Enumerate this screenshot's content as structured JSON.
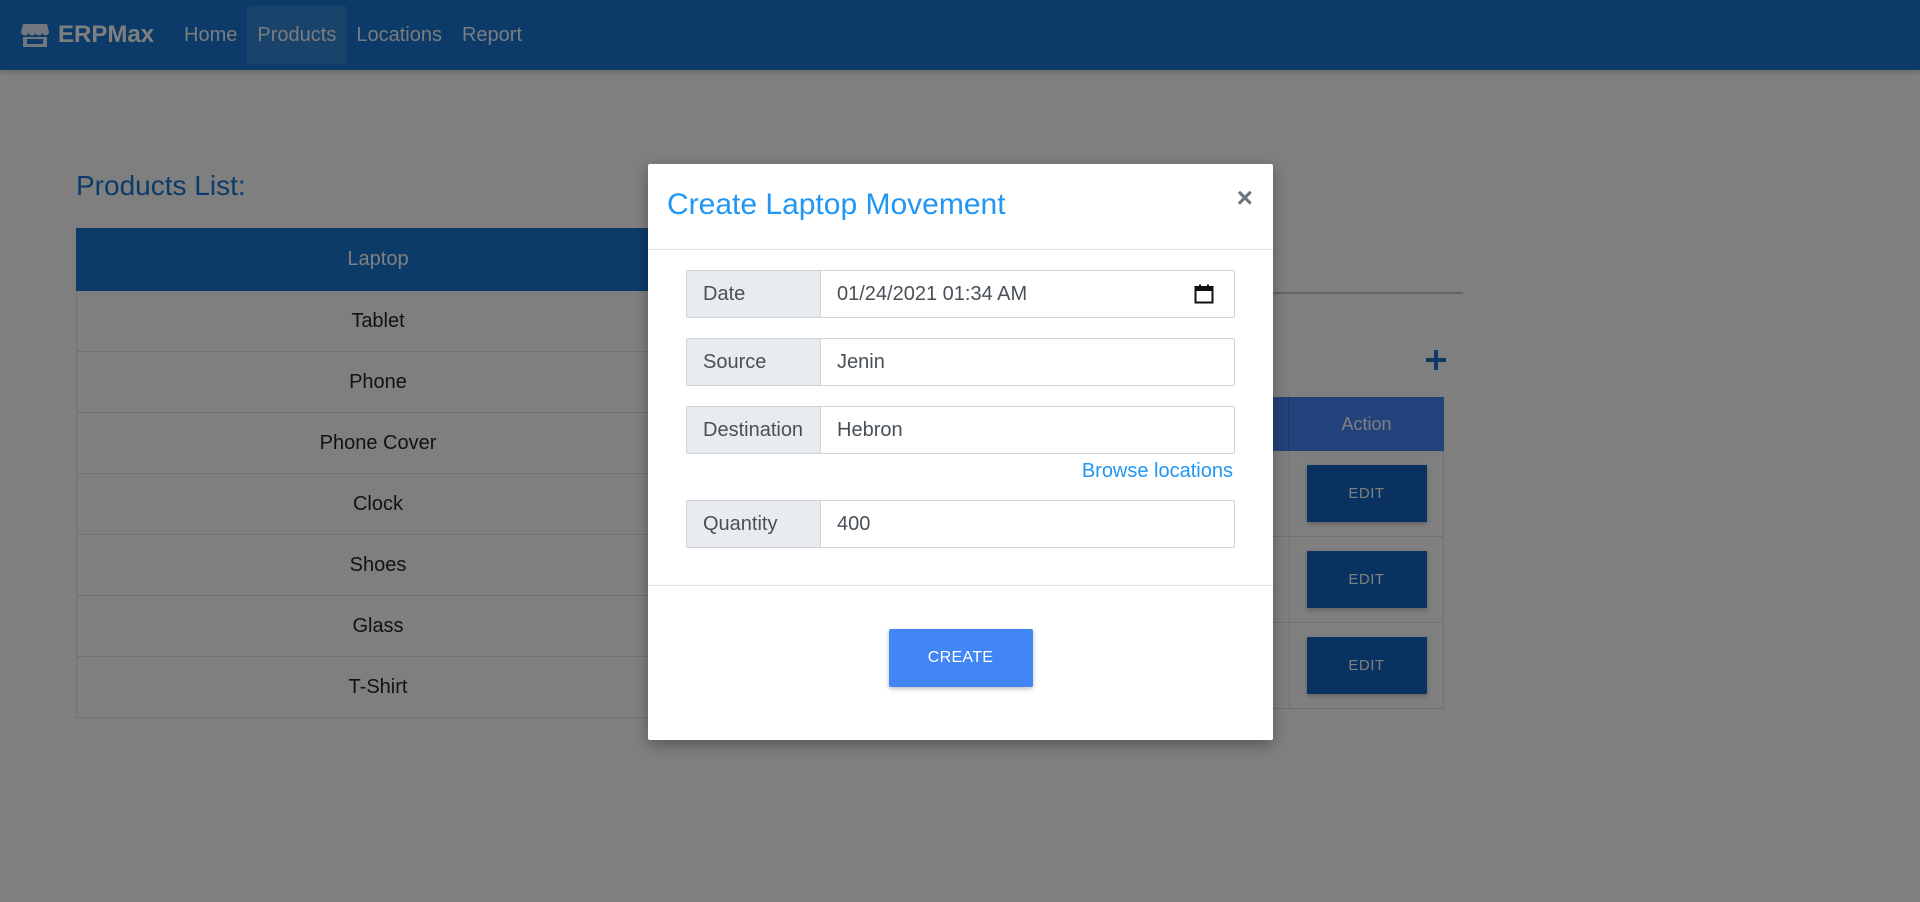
{
  "navbar": {
    "brand": "ERPMax",
    "brand_icon": "store-icon",
    "links": [
      "Home",
      "Products",
      "Locations",
      "Report"
    ],
    "active_link": "Products",
    "color": "#1976d2"
  },
  "products": {
    "title": "Products List:",
    "items": [
      "Laptop",
      "Tablet",
      "Phone",
      "Phone Cover",
      "Clock",
      "Shoes",
      "Glass",
      "T-Shirt"
    ],
    "selected": "Laptop"
  },
  "movements_table": {
    "action_header": "Action",
    "edit_label": "EDIT",
    "rows": 3
  },
  "modal": {
    "title": "Create Laptop Movement",
    "close_symbol": "×",
    "fields": {
      "date": {
        "label": "Date",
        "value": "01/24/2021 01:34  AM"
      },
      "source": {
        "label": "Source",
        "value": "Jenin"
      },
      "destination": {
        "label": "Destination",
        "value": "Hebron"
      },
      "quantity": {
        "label": "Quantity",
        "value": "400"
      }
    },
    "browse_link": "Browse locations",
    "create_label": "CREATE"
  }
}
